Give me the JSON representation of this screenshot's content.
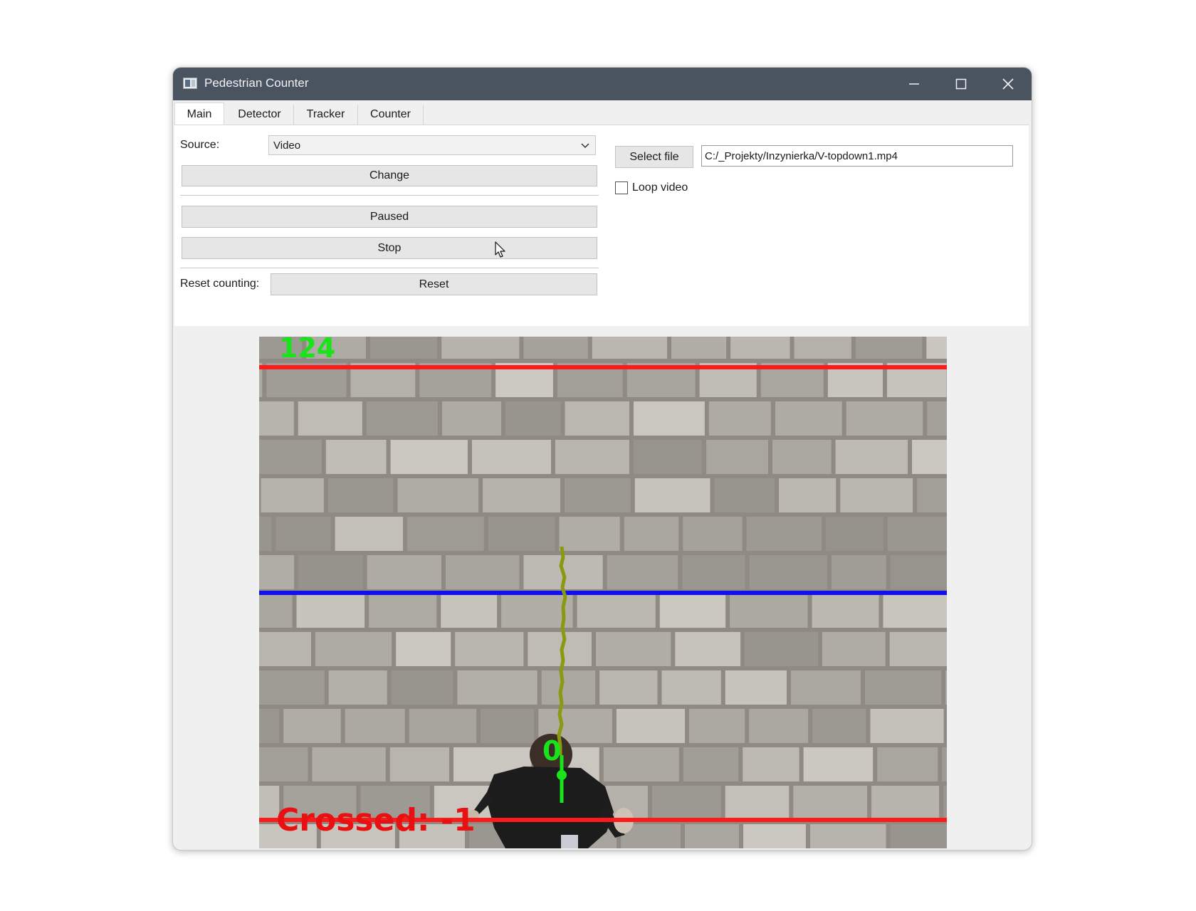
{
  "window": {
    "title": "Pedestrian Counter",
    "controls": [
      "minimize",
      "maximize",
      "close"
    ]
  },
  "tabs": [
    {
      "label": "Main",
      "active": true
    },
    {
      "label": "Detector",
      "active": false
    },
    {
      "label": "Tracker",
      "active": false
    },
    {
      "label": "Counter",
      "active": false
    }
  ],
  "main": {
    "source_label": "Source:",
    "source_value": "Video",
    "change_button": "Change",
    "paused_button": "Paused",
    "stop_button": "Stop",
    "reset_label": "Reset counting:",
    "reset_button": "Reset",
    "select_file_button": "Select file",
    "file_path": "C:/_Projekty/Inzynierka/V-topdown1.mp4",
    "loop_video_label": "Loop video",
    "loop_video_checked": false
  },
  "video": {
    "frame_counter": "124",
    "track_id": "0",
    "crossed_text": "Crossed: -1",
    "colors": {
      "boundary_line": "#ff1a1a",
      "counting_line": "#1010ee",
      "track_path": "#8a9a10",
      "overlay_green": "#19e319",
      "crossed_text": "#e81010"
    }
  },
  "icons": {
    "app": "app-window-icon",
    "minimize": "minimize-icon",
    "maximize": "maximize-icon",
    "close": "close-icon",
    "dropdown": "chevron-down-icon",
    "cursor": "mouse-cursor-icon"
  }
}
